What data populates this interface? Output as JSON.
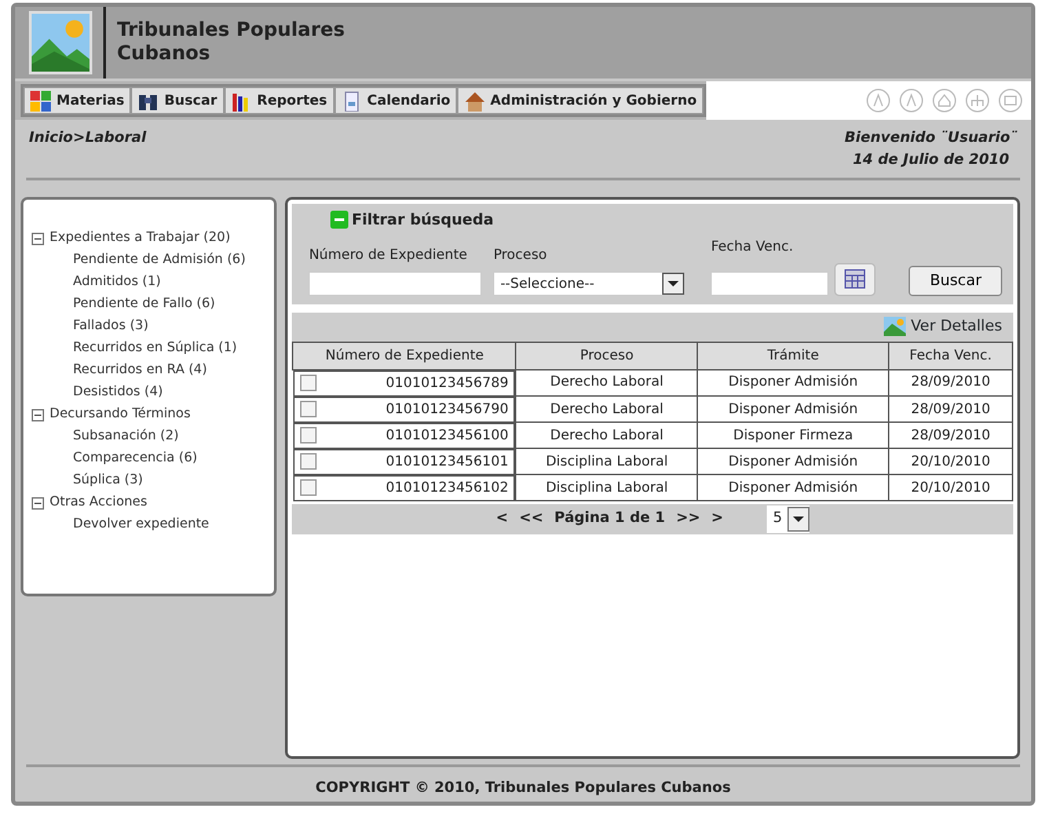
{
  "header": {
    "title": "Tribunales Populares Cubanos"
  },
  "menu": [
    {
      "label": "Materias"
    },
    {
      "label": "Buscar"
    },
    {
      "label": "Reportes"
    },
    {
      "label": "Calendario"
    },
    {
      "label": "Administración y Gobierno"
    }
  ],
  "breadcrumb": "Inicio>Laboral",
  "welcome": "Bienvenido ¨Usuario¨",
  "date": "14 de Julio de 2010",
  "tree": [
    {
      "label": "Expedientes a Trabajar (20)",
      "expanded": true,
      "children": [
        {
          "label": "Pendiente de Admisión (6)"
        },
        {
          "label": "Admitidos (1)"
        },
        {
          "label": "Pendiente de Fallo (6)"
        },
        {
          "label": "Fallados (3)"
        },
        {
          "label": "Recurridos en Súplica (1)"
        },
        {
          "label": "Recurridos en RA (4)"
        },
        {
          "label": "Desistidos (4)"
        }
      ]
    },
    {
      "label": "Decursando Términos",
      "expanded": true,
      "children": [
        {
          "label": "Subsanación (2)"
        },
        {
          "label": "Comparecencia (6)"
        },
        {
          "label": "Súplica (3)"
        }
      ]
    },
    {
      "label": "Otras Acciones",
      "expanded": true,
      "children": [
        {
          "label": "Devolver expediente"
        }
      ]
    }
  ],
  "filter": {
    "title": "Filtrar búsqueda",
    "expanded": true,
    "fields": [
      {
        "label": "Número de Expediente",
        "kind": "text"
      },
      {
        "label": "Proceso",
        "kind": "select",
        "value": "--Seleccione--"
      },
      {
        "label": "Fecha Venc.",
        "kind": "date"
      }
    ],
    "button": "Buscar"
  },
  "details_button": "Ver Detalles",
  "table": {
    "columns": [
      "Número de Expediente",
      "Proceso",
      "Trámite",
      "Fecha Venc."
    ],
    "rows": [
      {
        "checked": false,
        "cells": [
          "01010123456789",
          "Derecho Laboral",
          "Disponer Admisión",
          "28/09/2010"
        ]
      },
      {
        "checked": false,
        "cells": [
          "01010123456790",
          "Derecho Laboral",
          "Disponer Admisión",
          "28/09/2010"
        ]
      },
      {
        "checked": false,
        "cells": [
          "01010123456100",
          "Derecho Laboral",
          "Disponer Firmeza",
          "28/09/2010"
        ]
      },
      {
        "checked": false,
        "cells": [
          "01010123456101",
          "Disciplina Laboral",
          "Disponer Admisión",
          "20/10/2010"
        ]
      },
      {
        "checked": false,
        "cells": [
          "01010123456102",
          "Disciplina Laboral",
          "Disponer Admisión",
          "20/10/2010"
        ]
      }
    ]
  },
  "pager": {
    "first": "<",
    "prev": "<<",
    "page": "Página 1 de 1",
    "next": ">>",
    "last": ">",
    "page_size": "5"
  },
  "footer": "COPYRIGHT © 2010, Tribunales Populares Cubanos"
}
